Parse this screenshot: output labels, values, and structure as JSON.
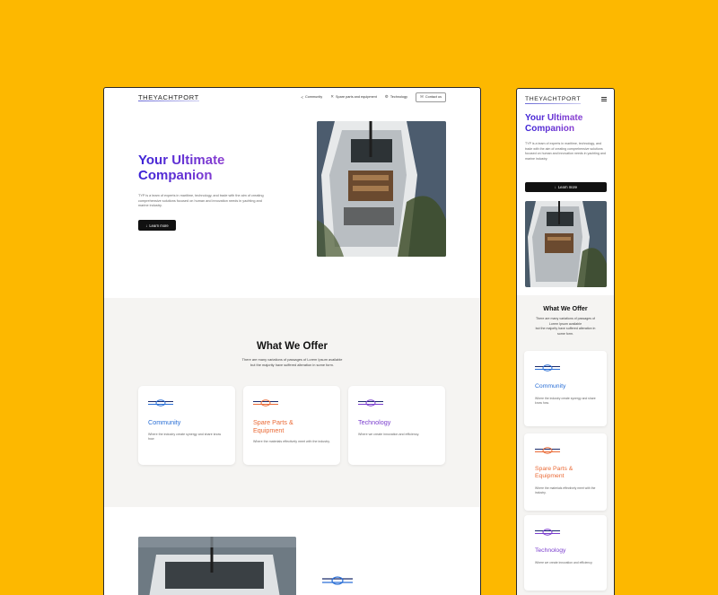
{
  "brand": {
    "logo_text": "THEYACHTPORT"
  },
  "nav": {
    "items": [
      {
        "label": "Community",
        "icon": "share-icon"
      },
      {
        "label": "Spare parts and equipment",
        "icon": "tools-icon"
      },
      {
        "label": "Technology",
        "icon": "gear-icon"
      }
    ],
    "contact_label": "Contact us",
    "contact_icon": "mail-icon"
  },
  "hero": {
    "title": "Your Ultimate Companion",
    "description": "TYP is a team of experts in maritime, technology, and trade with the aim of creating comprehensive solutions focused on human and innovation needs in yachting and marine industry.",
    "button_label": "Learn more"
  },
  "offer": {
    "title": "What We Offer",
    "subtitle_line1": "There are many variations of passages of Lorem Ipsum available",
    "subtitle_line2": "but the majority have suffered alteration in some form.",
    "mobile_subtitle_line1": "There are many variations of passages of",
    "mobile_subtitle_line2": "Lorem Ipsum available",
    "mobile_subtitle_line3": "but the majority have suffered alteration in",
    "mobile_subtitle_line4": "some form.",
    "cards": [
      {
        "title": "Community",
        "description": "Where the industry create synergy and share know how",
        "mobile_description": "Where the industry create synergy and share know how.",
        "color": "#2a6fd6"
      },
      {
        "title": "Spare Parts & Equipment",
        "description": "Where the materials effectively meet with the industry.",
        "color": "#ea6a36"
      },
      {
        "title": "Technology",
        "description": "Where we create innovation and efficiency.",
        "color": "#7b3fce"
      }
    ]
  },
  "colors": {
    "background": "#FDB800",
    "title_gradient_start": "#3b22d6",
    "title_gradient_mid": "#8a3fd1",
    "button": "#111111"
  }
}
